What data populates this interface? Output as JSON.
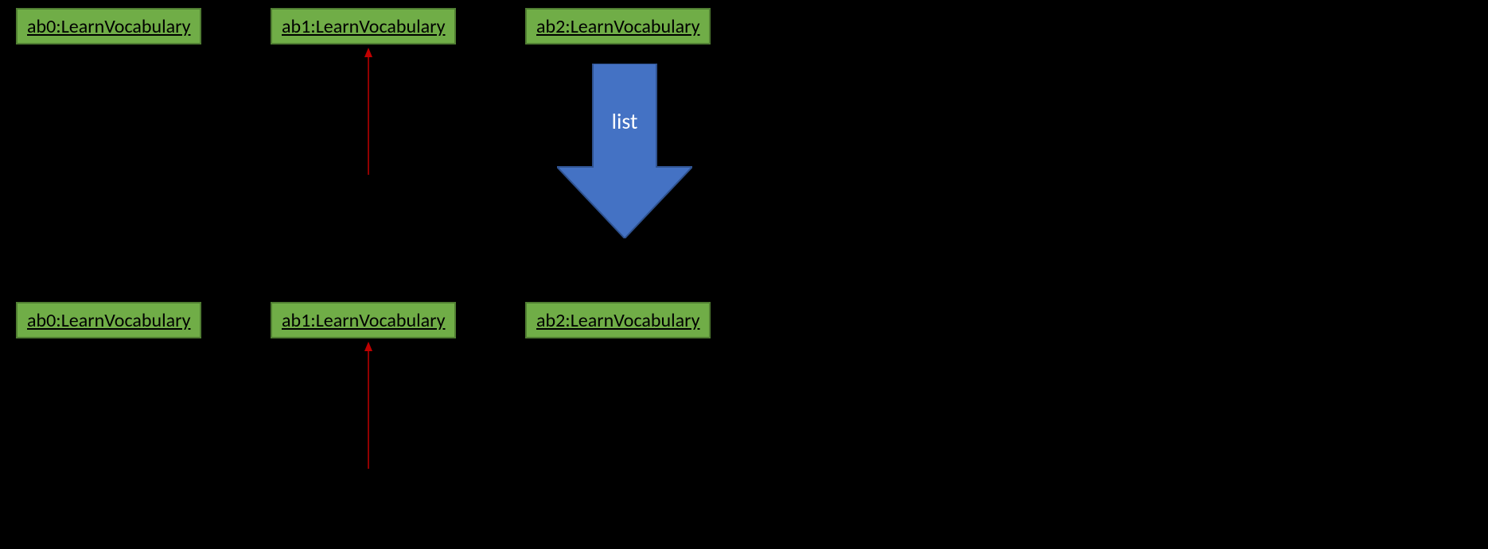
{
  "nodes": {
    "top": [
      {
        "label": "ab0:LearnVocabulary"
      },
      {
        "label": "ab1:LearnVocabulary"
      },
      {
        "label": "ab2:LearnVocabulary"
      }
    ],
    "bottom": [
      {
        "label": "ab0:LearnVocabulary"
      },
      {
        "label": "ab1:LearnVocabulary"
      },
      {
        "label": "ab2:LearnVocabulary"
      }
    ]
  },
  "arrow": {
    "label": "list"
  },
  "colors": {
    "node_fill": "#70AD47",
    "node_border": "#507E32",
    "big_arrow": "#4472C4",
    "small_arrow": "#C00000",
    "bg": "#000000"
  }
}
